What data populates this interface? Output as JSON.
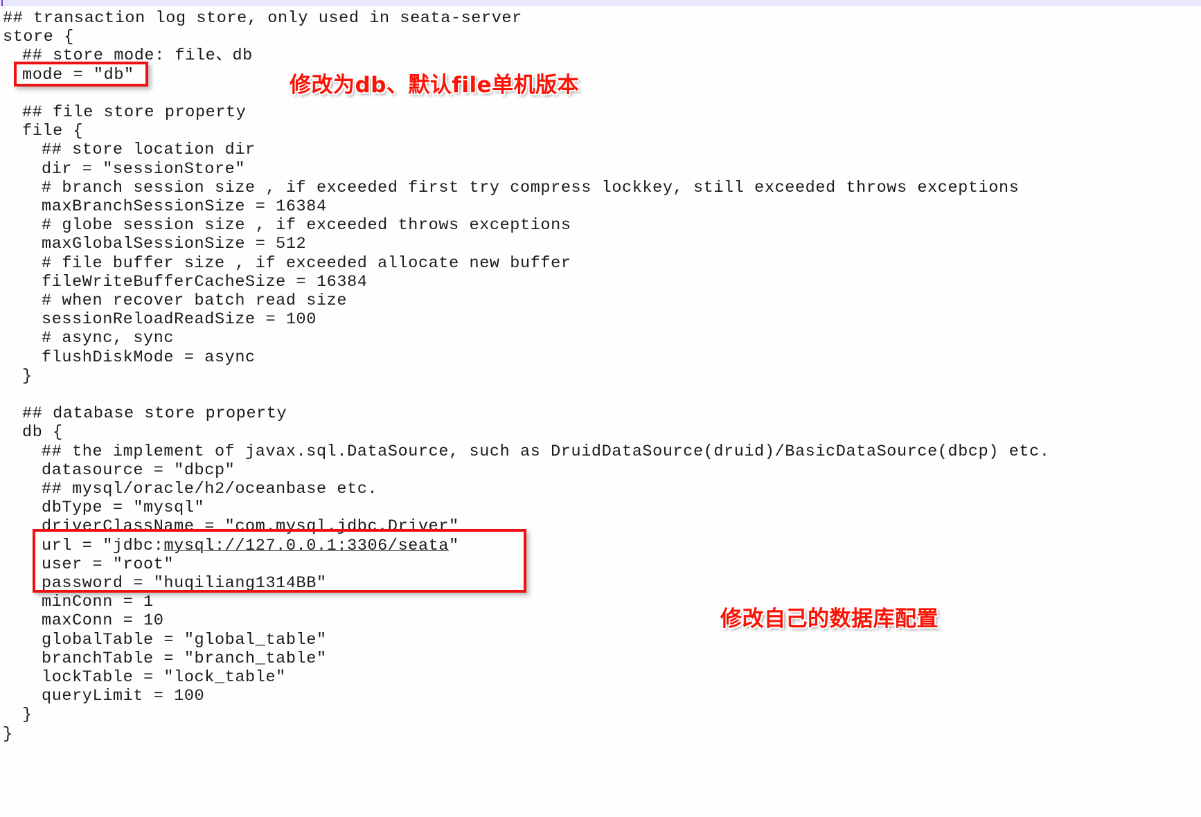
{
  "editor": {
    "top_strip_color": "#e8e7fb",
    "caret_color": "#7b3fbf",
    "text_color": "#1b1b1b",
    "background_color": "#fefefe"
  },
  "code": {
    "language": "hocon-conf",
    "lines": [
      {
        "indent": 0,
        "text": "## transaction log store, only used in seata-server"
      },
      {
        "indent": 0,
        "text": "store {"
      },
      {
        "indent": 1,
        "text": "## store mode: file、db"
      },
      {
        "indent": 1,
        "text": "mode = \"db\""
      },
      {
        "indent": 0,
        "text": ""
      },
      {
        "indent": 1,
        "text": "## file store property"
      },
      {
        "indent": 1,
        "text": "file {"
      },
      {
        "indent": 2,
        "text": "## store location dir"
      },
      {
        "indent": 2,
        "text": "dir = \"sessionStore\""
      },
      {
        "indent": 2,
        "text": "# branch session size , if exceeded first try compress lockkey, still exceeded throws exceptions"
      },
      {
        "indent": 2,
        "text": "maxBranchSessionSize = 16384"
      },
      {
        "indent": 2,
        "text": "# globe session size , if exceeded throws exceptions"
      },
      {
        "indent": 2,
        "text": "maxGlobalSessionSize = 512"
      },
      {
        "indent": 2,
        "text": "# file buffer size , if exceeded allocate new buffer"
      },
      {
        "indent": 2,
        "text": "fileWriteBufferCacheSize = 16384"
      },
      {
        "indent": 2,
        "text": "# when recover batch read size"
      },
      {
        "indent": 2,
        "text": "sessionReloadReadSize = 100"
      },
      {
        "indent": 2,
        "text": "# async, sync"
      },
      {
        "indent": 2,
        "text": "flushDiskMode = async"
      },
      {
        "indent": 1,
        "text": "}"
      },
      {
        "indent": 0,
        "text": ""
      },
      {
        "indent": 1,
        "text": "## database store property"
      },
      {
        "indent": 1,
        "text": "db {"
      },
      {
        "indent": 2,
        "text": "## the implement of javax.sql.DataSource, such as DruidDataSource(druid)/BasicDataSource(dbcp) etc."
      },
      {
        "indent": 2,
        "text": "datasource = \"dbcp\""
      },
      {
        "indent": 2,
        "text": "## mysql/oracle/h2/oceanbase etc."
      },
      {
        "indent": 2,
        "text": "dbType = \"mysql\""
      },
      {
        "indent": 2,
        "text": "driverClassName = \"com.mysql.jdbc.Driver\""
      },
      {
        "indent": 2,
        "text": "url = \"jdbc:mysql://127.0.0.1:3306/seata\"",
        "link": "mysql://127.0.0.1:3306/seata"
      },
      {
        "indent": 2,
        "text": "user = \"root\""
      },
      {
        "indent": 2,
        "text": "password = \"huqiliang1314BB\""
      },
      {
        "indent": 2,
        "text": "minConn = 1"
      },
      {
        "indent": 2,
        "text": "maxConn = 10"
      },
      {
        "indent": 2,
        "text": "globalTable = \"global_table\""
      },
      {
        "indent": 2,
        "text": "branchTable = \"branch_table\""
      },
      {
        "indent": 2,
        "text": "lockTable = \"lock_table\""
      },
      {
        "indent": 2,
        "text": "queryLimit = 100"
      },
      {
        "indent": 1,
        "text": "}"
      },
      {
        "indent": 0,
        "text": "}"
      }
    ]
  },
  "annotations": {
    "color": "#fb1306",
    "box_color": "#ee1111",
    "items": [
      {
        "id": "mode-note",
        "label": "修改为db、默认file单机版本",
        "targets_line": "mode = \"db\""
      },
      {
        "id": "db-config-note",
        "label": "修改自己的数据库配置",
        "targets_line": "url / user / password"
      }
    ]
  }
}
